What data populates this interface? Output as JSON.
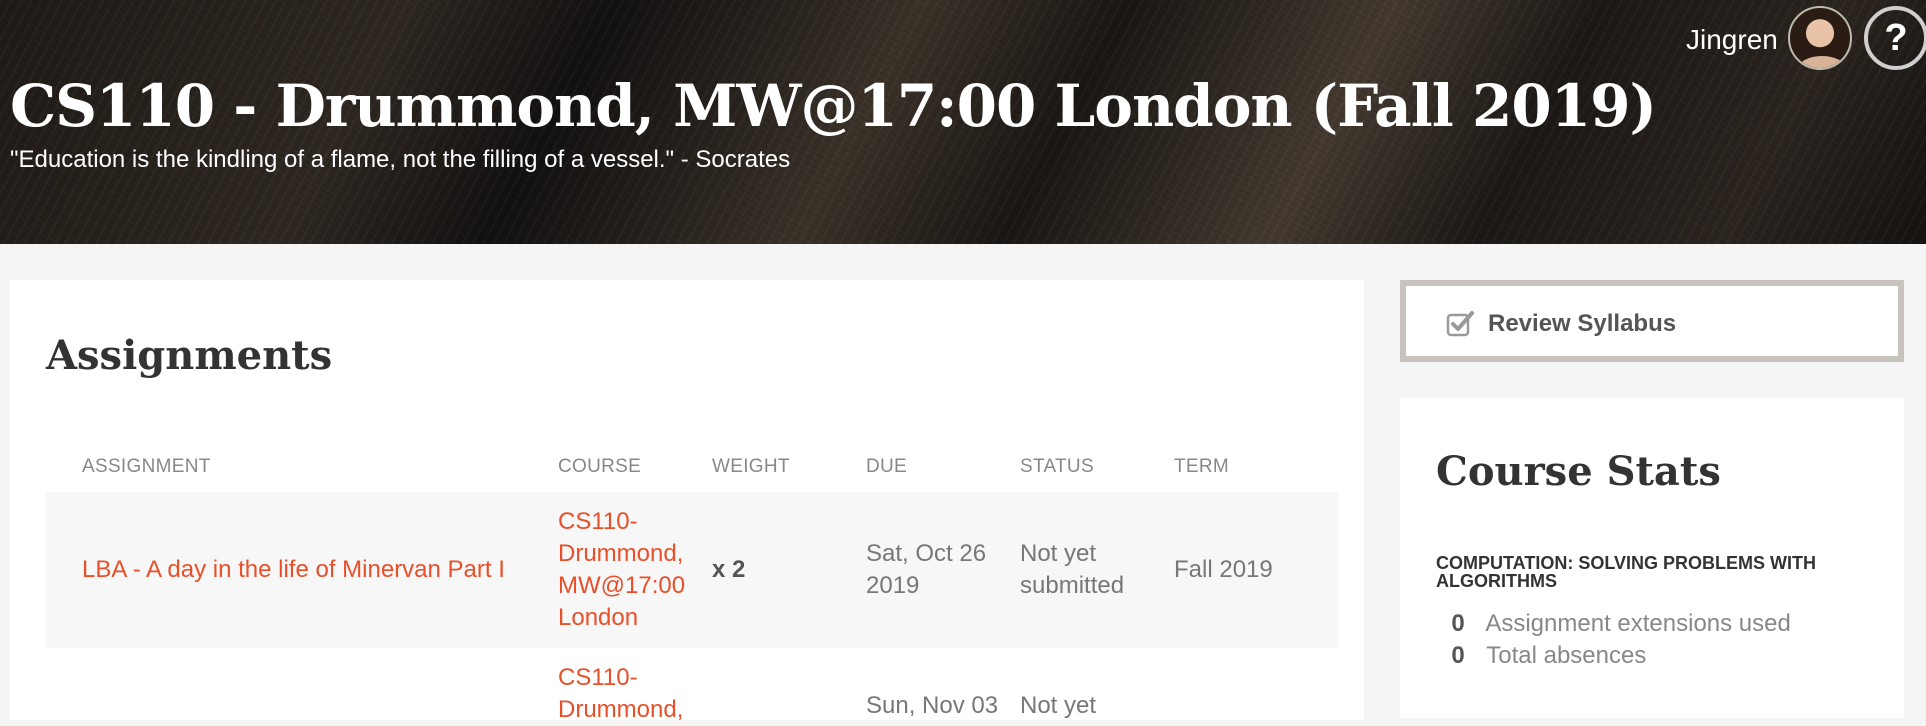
{
  "header": {
    "course_title": "CS110 - Drummond, MW@17:00 London (Fall 2019)",
    "quote": "\"Education is the kindling of a flame, not the filling of a vessel.\" - Socrates",
    "user_name": "Jingren",
    "help_label": "?"
  },
  "assignments": {
    "title": "Assignments",
    "columns": [
      "ASSIGNMENT",
      "COURSE",
      "WEIGHT",
      "DUE",
      "STATUS",
      "TERM"
    ],
    "rows": [
      {
        "assignment": "LBA - A day in the life of Minervan Part I",
        "course_lines": [
          "CS110-",
          "Drummond,",
          "MW@17:00",
          "London"
        ],
        "weight": "x 2",
        "due_lines": [
          "Sat, Oct 26",
          "2019"
        ],
        "status_lines": [
          "Not yet",
          "submitted"
        ],
        "term": "Fall 2019"
      },
      {
        "course_lines": [
          "CS110-",
          "Drummond,"
        ],
        "due_lines": [
          "Sun, Nov 03"
        ],
        "status_lines": [
          "Not yet"
        ]
      }
    ]
  },
  "sidebar": {
    "syllabus_label": "Review Syllabus",
    "stats_title": "Course Stats",
    "course_name": "COMPUTATION: SOLVING PROBLEMS WITH ALGORITHMS",
    "stats": [
      {
        "value": "0",
        "label": "Assignment extensions used"
      },
      {
        "value": "0",
        "label": "Total absences"
      }
    ]
  },
  "colors": {
    "accent_link": "#e8502a",
    "panel_bg": "#ffffff",
    "page_bg": "#f5f5f5"
  }
}
